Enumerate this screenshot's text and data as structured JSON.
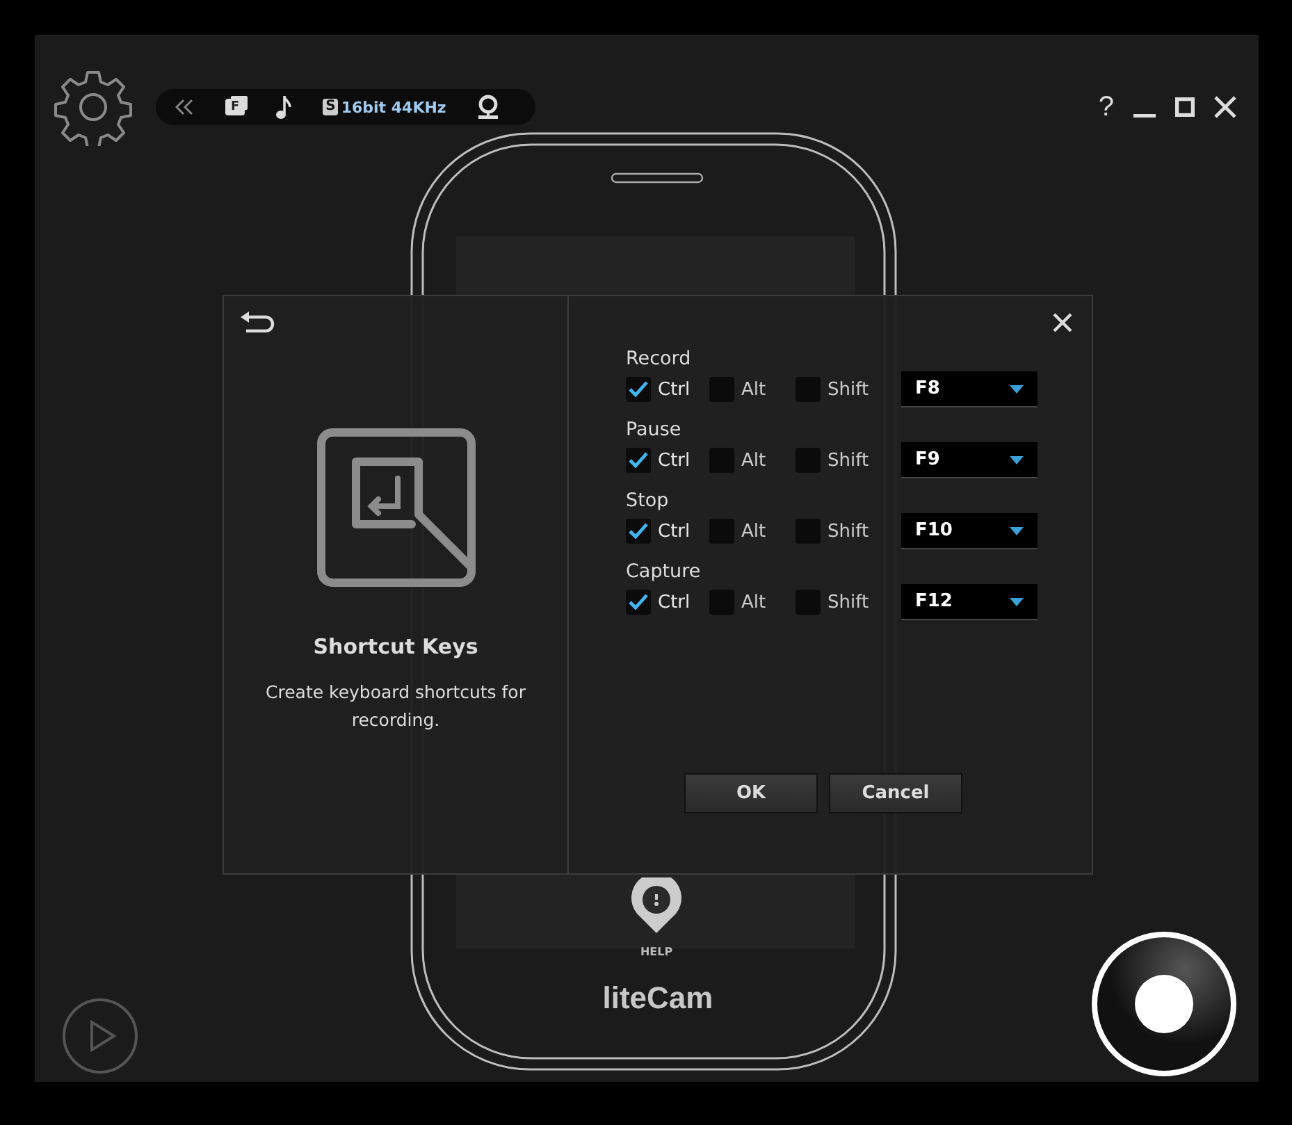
{
  "toolbar": {
    "screen_badge": "F",
    "sound_badge": "S",
    "audio_format": "16bit 44KHz"
  },
  "window_controls": {
    "help": "?"
  },
  "phone": {
    "help_label": "HELP",
    "logo": "liteCam"
  },
  "dialog": {
    "title": "Shortcut Keys",
    "description": "Create keyboard shortcuts for recording.",
    "shortcuts": [
      {
        "action": "Record",
        "modifiers": [
          {
            "label": "Ctrl",
            "checked": true
          },
          {
            "label": "Alt",
            "checked": false
          },
          {
            "label": "Shift",
            "checked": false
          }
        ],
        "key": "F8"
      },
      {
        "action": "Pause",
        "modifiers": [
          {
            "label": "Ctrl",
            "checked": true
          },
          {
            "label": "Alt",
            "checked": false
          },
          {
            "label": "Shift",
            "checked": false
          }
        ],
        "key": "F9"
      },
      {
        "action": "Stop",
        "modifiers": [
          {
            "label": "Ctrl",
            "checked": true
          },
          {
            "label": "Alt",
            "checked": false
          },
          {
            "label": "Shift",
            "checked": false
          }
        ],
        "key": "F10"
      },
      {
        "action": "Capture",
        "modifiers": [
          {
            "label": "Ctrl",
            "checked": true
          },
          {
            "label": "Alt",
            "checked": false
          },
          {
            "label": "Shift",
            "checked": false
          }
        ],
        "key": "F12"
      }
    ],
    "buttons": [
      "OK",
      "Cancel"
    ]
  }
}
